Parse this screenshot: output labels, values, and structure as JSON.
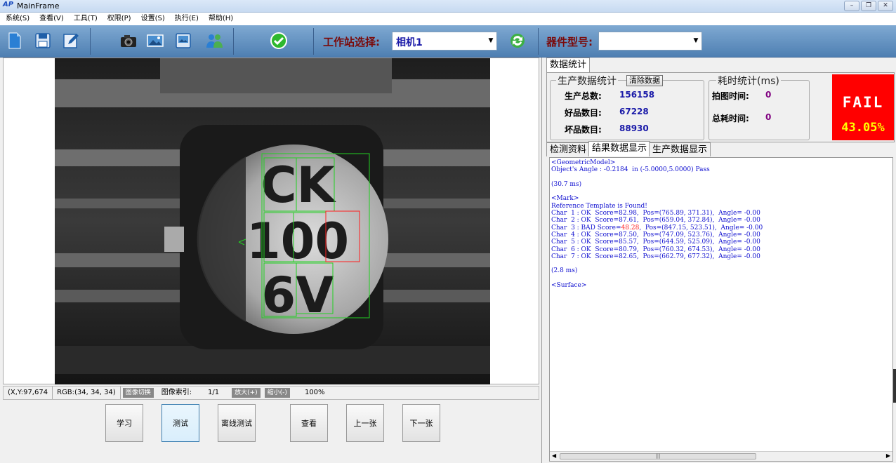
{
  "window": {
    "title": "MainFrame",
    "app_icon": "AP",
    "buttons": [
      "–",
      "❐",
      "✕"
    ]
  },
  "menu": [
    "系统(S)",
    "查看(V)",
    "工具(T)",
    "权限(P)",
    "设置(S)",
    "执行(E)",
    "帮助(H)"
  ],
  "toolbar": {
    "station_label": "工作站选择:",
    "station_value": "相机1",
    "device_label": "器件型号:",
    "device_value": "",
    "icons": [
      "open-file-icon",
      "save-icon",
      "edit-icon",
      "camera-icon",
      "image-icon",
      "image-save-icon",
      "users-icon",
      "check-icon",
      "refresh-icon"
    ]
  },
  "status": {
    "coords": "(X,Y:97,674",
    "rgb": "RGB:(34, 34, 34)",
    "switch_label": "图像切换",
    "index_label": "图像索引:",
    "index_value": "1/1",
    "zoom_in": "放大(+)",
    "zoom_out": "缩小(-)",
    "zoom_value": "100%"
  },
  "actions": [
    "学习",
    "测试",
    "离线测试",
    "查看",
    "上一张",
    "下一张"
  ],
  "stats": {
    "tab": "数据统计",
    "prod_title": "生产数据统计",
    "clear_label": "清除数据",
    "total_label": "生产总数:",
    "total_value": "156158",
    "good_label": "好品数目:",
    "good_value": "67228",
    "bad_label": "坏品数目:",
    "bad_value": "88930",
    "time_title": "耗时统计(ms)",
    "capture_label": "拍图时间:",
    "capture_value": "0",
    "total_time_label": "总耗时间:",
    "total_time_value": "0",
    "result_text": "FAIL",
    "result_percent": "43.05%",
    "result_color": "#ff0000"
  },
  "result_tabs": [
    "检测资料",
    "结果数据显示",
    "生产数据显示"
  ],
  "results": {
    "l1": "<GeometricModel>",
    "l2": "Object's Angle : -0.2184  in (-5.0000,5.0000) Pass",
    "l3": "(30.7 ms)",
    "l4": "<Mark>",
    "l5": "Reference Template is Found!",
    "c1": "Char  1 : OK  Score=82.98,  Pos=(765.89, 371.31),  Angle= -0.00",
    "c2": "Char  2 : OK  Score=87.61,  Pos=(659.04, 372.84),  Angle= -0.00",
    "c3a": "Char  3 : BAD Score=",
    "c3b": "48.28",
    "c3c": ",  Pos=(847.15, 523.51),  Angle= -0.00",
    "c4": "Char  4 : OK  Score=87.50,  Pos=(747.09, 523.76),  Angle= -0.00",
    "c5": "Char  5 : OK  Score=85.57,  Pos=(644.59, 525.09),  Angle= -0.00",
    "c6": "Char  6 : OK  Score=80.79,  Pos=(760.32, 674.53),  Angle= -0.00",
    "c7": "Char  7 : OK  Score=82.65,  Pos=(662.79, 677.32),  Angle= -0.00",
    "l6": "(2.8 ms)",
    "l7": "<Surface>"
  },
  "image_marks": {
    "line1": "CK",
    "line2": "100",
    "line3": "6V"
  }
}
